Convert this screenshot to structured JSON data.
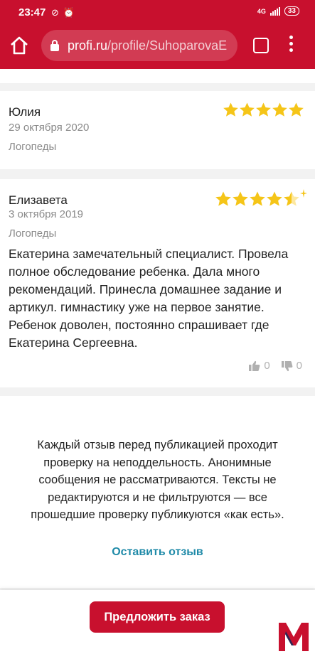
{
  "status_bar": {
    "time": "23:47",
    "network": "4G",
    "battery": "33"
  },
  "browser": {
    "url_domain": "profi.ru",
    "url_path": "/profile/SuhoparovaE"
  },
  "reviews": [
    {
      "name": "Юлия",
      "date": "29 октября 2020",
      "category": "Логопеды",
      "rating": 5
    },
    {
      "name": "Елизавета",
      "date": "3 октября 2019",
      "category": "Логопеды",
      "rating": 4.5,
      "text": "Екатерина замечательный специалист. Провела полное обследование ребенка. Дала много рекомендаций. Принесла домашнее задание и артикул. гимнастику уже на первое занятие. Ребенок доволен, постоянно спрашивает где Екатерина Сергеевна.",
      "likes": "0",
      "dislikes": "0"
    }
  ],
  "notice": "Каждый отзыв перед публикацией проходит проверку на неподдельность. Анонимные сообщения не рассматриваются. Тексты не редактируются и не фильтруются — все прошедшие проверку публикуются «как есть».",
  "leave_review_label": "Оставить отзыв",
  "order_button_label": "Предложить заказ",
  "colors": {
    "brand": "#c8102e",
    "star": "#f5c518",
    "link": "#1f8aa8"
  }
}
